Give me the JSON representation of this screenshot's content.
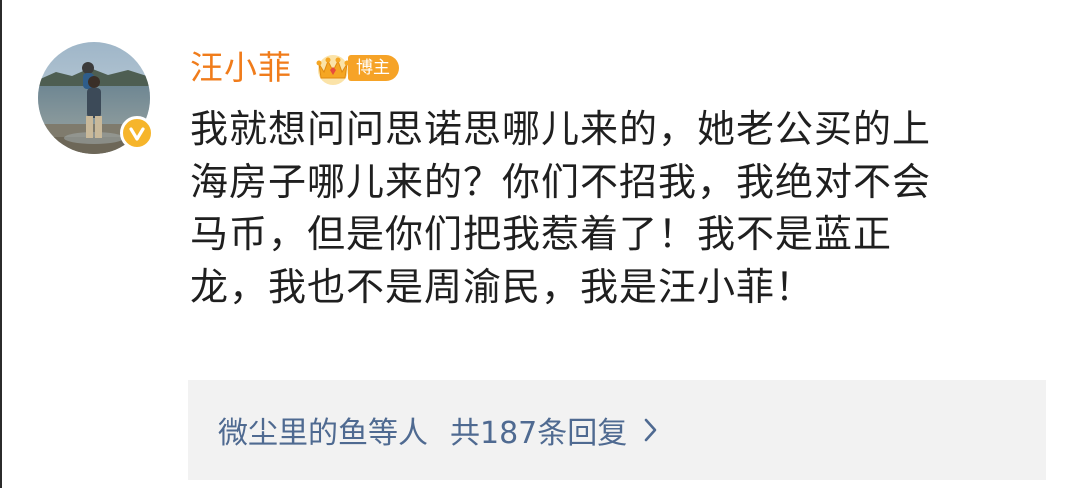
{
  "comment": {
    "username": "汪小菲",
    "badge_label": "博主",
    "content_lines": [
      "我就想问问思诺思哪儿来的，她老公买的上",
      "海房子哪儿来的？你们不招我，我绝对不会",
      "马币，但是你们把我惹着了！我不是蓝正",
      "龙，我也不是周渝民，我是汪小菲！"
    ]
  },
  "replies": {
    "users_text": "微尘里的鱼等人",
    "count_text": "共187条回复"
  },
  "colors": {
    "username": "#f07c1b",
    "badge": "#f6a327",
    "verified": "#f6b52b",
    "reply_link": "#4f6a91",
    "reply_bg": "#f2f2f2",
    "text": "#1f1f1f"
  },
  "icons": {
    "verified": "verified-v-icon",
    "crown": "crown-icon",
    "more": "chevron-right-icon"
  }
}
